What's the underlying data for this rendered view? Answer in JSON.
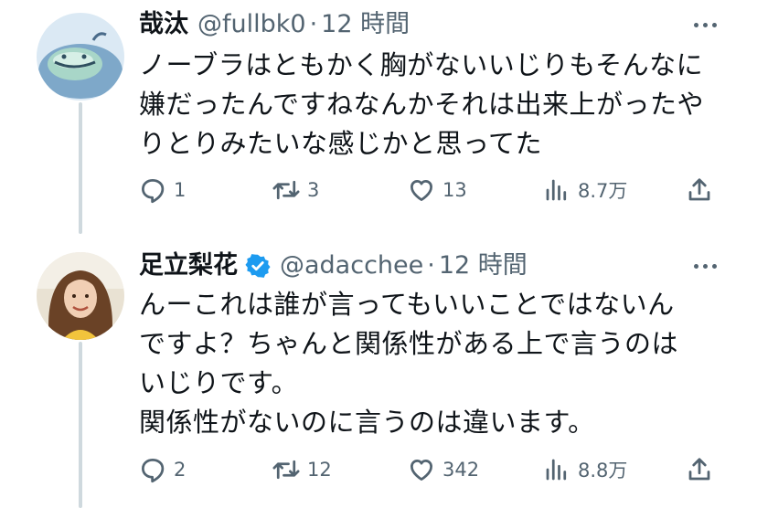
{
  "tweets": [
    {
      "display_name": "哉汰",
      "handle": "@fullbk0",
      "separator": "·",
      "time": "12 時間",
      "verified": false,
      "text": "ノーブラはともかく胸がないいじりもそんなに\n嫌だったんですねなんかそれは出来上がったや\nりとりみたいな感じかと思ってた",
      "reply_count": "1",
      "retweet_count": "3",
      "like_count": "13",
      "view_count": "8.7万"
    },
    {
      "display_name": "足立梨花",
      "handle": "@adacchee",
      "separator": "·",
      "time": "12 時間",
      "verified": true,
      "text": "んーこれは誰が言ってもいいことではないん\nですよ？ちゃんと関係性がある上で言うのは\nいじりです。\n関係性がないのに言うのは違います。",
      "reply_count": "2",
      "retweet_count": "12",
      "like_count": "342",
      "view_count": "8.8万"
    }
  ],
  "colors": {
    "text": "#0f1419",
    "secondary": "#536471",
    "thread_line": "#cfd9de",
    "verified": "#1d9bf0"
  },
  "icons": [
    "more-icon",
    "reply-icon",
    "retweet-icon",
    "like-icon",
    "views-icon",
    "share-icon",
    "verified-badge-icon"
  ]
}
